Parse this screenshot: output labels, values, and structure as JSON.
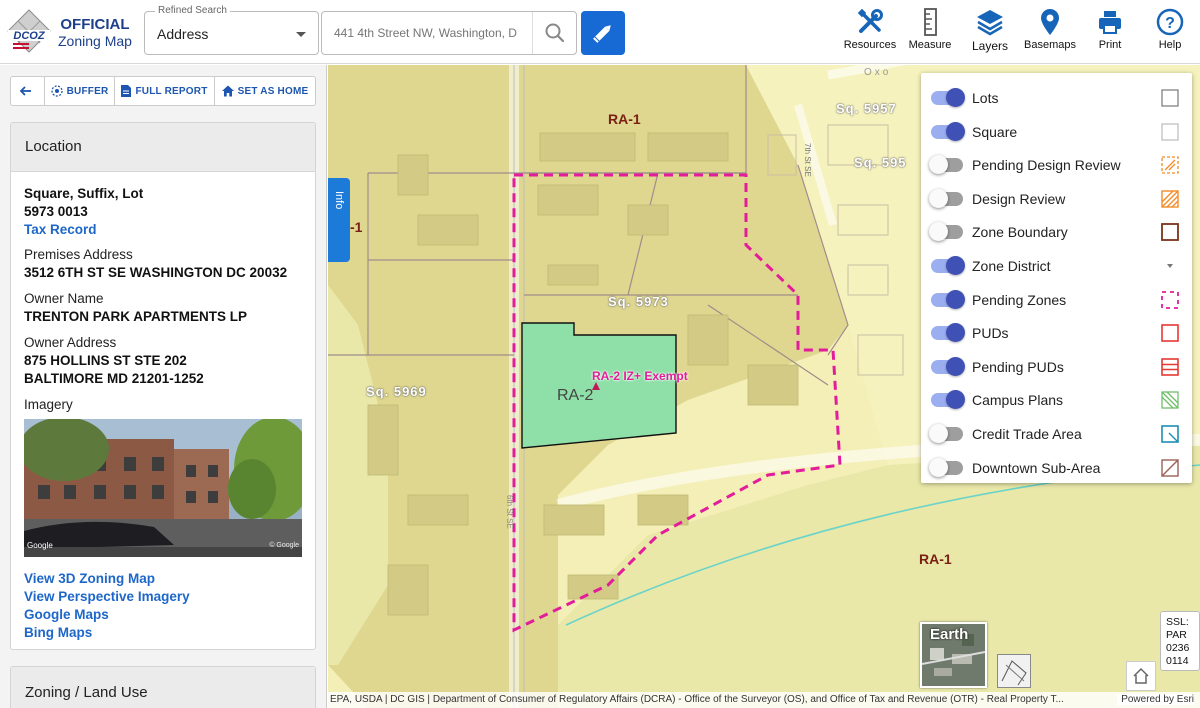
{
  "header": {
    "logo_abbr": "DCOZ",
    "logo_line1": "OFFICIAL",
    "logo_line2": "Zoning Map",
    "search_type_label": "Refined Search",
    "search_type_value": "Address",
    "search_placeholder": "441 4th Street NW, Washington, D",
    "tools": [
      {
        "label": "Resources",
        "icon": "tools-icon"
      },
      {
        "label": "Measure",
        "icon": "ruler-icon"
      },
      {
        "label": "Layers",
        "icon": "layers-icon"
      },
      {
        "label": "Basemaps",
        "icon": "map-pin-icon"
      },
      {
        "label": "Print",
        "icon": "printer-icon"
      },
      {
        "label": "Help",
        "icon": "help-icon"
      }
    ]
  },
  "sidebar": {
    "actions": {
      "buffer": "BUFFER",
      "full_report": "FULL REPORT",
      "set_as_home": "SET AS HOME"
    },
    "location": {
      "title": "Location",
      "ssl_label": "Square, Suffix, Lot",
      "ssl_value": "5973 0013",
      "tax_record": "Tax Record",
      "premises_label": "Premises Address",
      "premises_value": "3512 6TH ST SE WASHINGTON DC 20032",
      "owner_label": "Owner Name",
      "owner_value": "TRENTON PARK APARTMENTS LP",
      "owner_addr_label": "Owner Address",
      "owner_addr_line1": "875 HOLLINS ST STE 202",
      "owner_addr_line2": "BALTIMORE MD 21201-1252",
      "imagery_label": "Imagery",
      "photo_google": "Google",
      "photo_copyright": "© Google",
      "links": [
        "View 3D Zoning Map",
        "View Perspective Imagery",
        "Google Maps",
        "Bing Maps"
      ]
    },
    "zoning": {
      "title": "Zoning / Land Use"
    }
  },
  "map": {
    "labels": {
      "ra1_top": "RA-1",
      "ra1_left": "-1",
      "ra1_bottom": "RA-1",
      "ra2": "RA-2",
      "ra2_exempt": "RA-2 IZ+ Exempt",
      "sq5957": "Sq. 5957",
      "sq595": "Sq. 595",
      "sq5973": "Sq. 5973",
      "sq5969": "Sq. 5969",
      "street_7th": "7th St SE",
      "street_oxon": "Oxo",
      "street_6th": "6th St SE"
    },
    "info_tab": "Info",
    "earth_label": "Earth",
    "ssl_box": [
      "SSL:",
      "PAR",
      "0236",
      "0114"
    ],
    "attribution": "EPA, USDA | DC GIS | Department of Consumer of Regulatory Affairs (DCRA) - Office of the Surveyor (OS), and Office of Tax and Revenue (OTR) - Real Property T...",
    "powered_by": "Powered by Esri",
    "colors": {
      "base": "#f4efb7",
      "ra1": "#e0da94",
      "ra2": "#8fe0a8",
      "pending": "#e21c9b",
      "lot_line": "#a08c8c"
    }
  },
  "legend": [
    {
      "name": "Lots",
      "on": true,
      "symbol": "lots-swatch-icon"
    },
    {
      "name": "Square",
      "on": true,
      "symbol": "square-swatch-icon"
    },
    {
      "name": "Pending Design Review",
      "on": false,
      "symbol": "pending-design-review-swatch-icon"
    },
    {
      "name": "Design Review",
      "on": false,
      "symbol": "design-review-swatch-icon"
    },
    {
      "name": "Zone Boundary",
      "on": false,
      "symbol": "zone-boundary-swatch-icon"
    },
    {
      "name": "Zone District",
      "on": true,
      "symbol": "expand-caret-icon"
    },
    {
      "name": "Pending Zones",
      "on": true,
      "symbol": "pending-zones-swatch-icon"
    },
    {
      "name": "PUDs",
      "on": true,
      "symbol": "puds-swatch-icon"
    },
    {
      "name": "Pending PUDs",
      "on": true,
      "symbol": "pending-puds-swatch-icon"
    },
    {
      "name": "Campus Plans",
      "on": true,
      "symbol": "campus-plans-swatch-icon"
    },
    {
      "name": "Credit Trade Area",
      "on": false,
      "symbol": "credit-trade-area-swatch-icon"
    },
    {
      "name": "Downtown Sub-Area",
      "on": false,
      "symbol": "downtown-sub-area-swatch-icon"
    }
  ]
}
